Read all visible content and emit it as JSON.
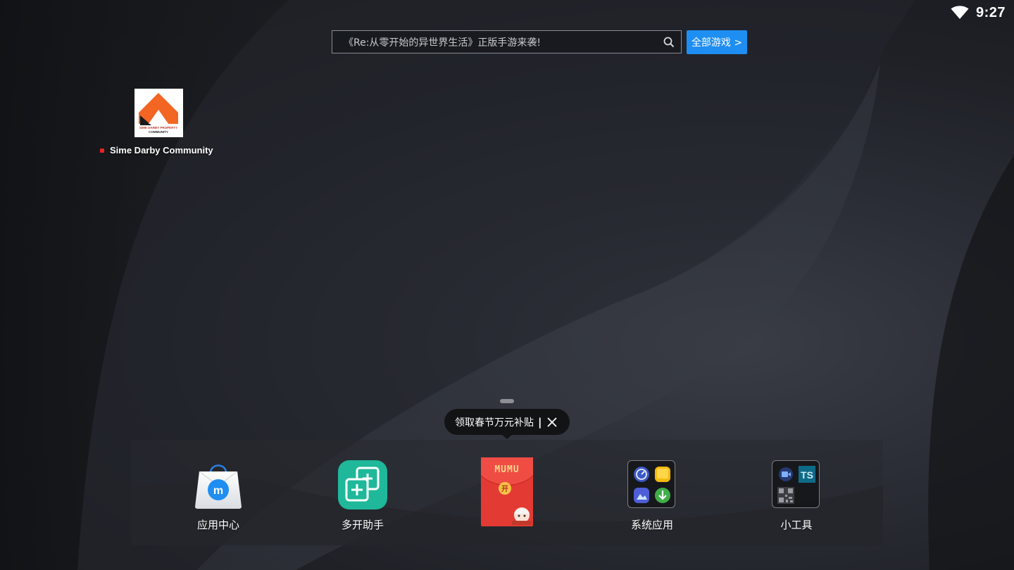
{
  "status_bar": {
    "time": "9:27",
    "wifi_icon": "wifi-icon"
  },
  "search": {
    "placeholder": "《Re:从零开始的异世界生活》正版手游来袭!",
    "icon": "search-icon",
    "all_games_label": "全部游戏 >"
  },
  "desktop": {
    "apps": [
      {
        "label": "Sime Darby Community",
        "logo_text_1": "SIME DARBY PROPERTY",
        "logo_text_2": "COMMUNITY",
        "has_new_badge": true
      }
    ]
  },
  "tooltip": {
    "text": "领取春节万元补贴",
    "separator": "|",
    "close_icon": "close-icon"
  },
  "dock": {
    "items": [
      {
        "label": "应用中心",
        "icon": "app-center-bag-icon"
      },
      {
        "label": "多开助手",
        "icon": "multi-instance-icon"
      },
      {
        "label": "",
        "icon": "red-envelope-icon",
        "envelope_text": "MUMU",
        "seal_text": "开"
      },
      {
        "label": "系统应用",
        "icon": "system-apps-folder-icon"
      },
      {
        "label": "小工具",
        "icon": "tools-folder-icon"
      }
    ]
  },
  "colors": {
    "accent_blue": "#1e8ef2",
    "envelope_red": "#e33a33",
    "multi_green": "#1fb89a",
    "badge_red": "#e52424"
  }
}
